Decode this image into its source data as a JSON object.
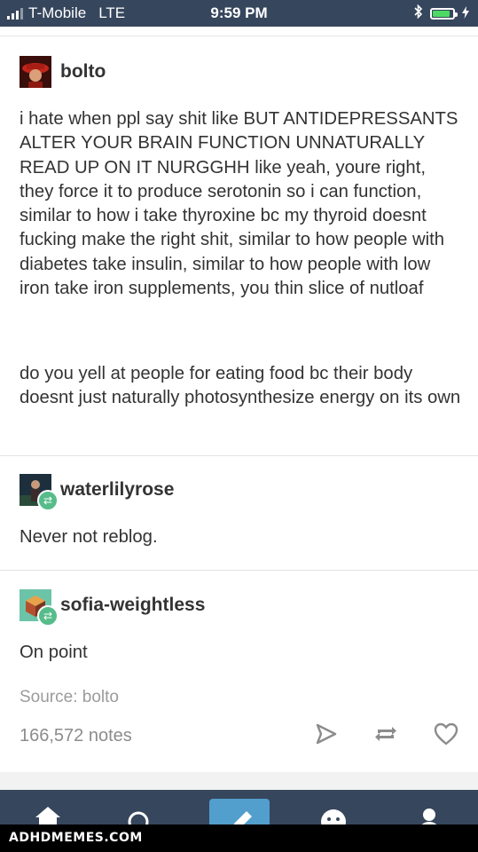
{
  "status_bar": {
    "carrier": "T-Mobile",
    "network": "LTE",
    "time": "9:59 PM",
    "battery_fraction": 0.85
  },
  "posts": [
    {
      "username": "bolto",
      "paragraphs": [
        "i hate when ppl say shit like BUT ANTIDEPRESSANTS ALTER YOUR BRAIN FUNCTION UNNATURALLY READ UP ON IT NURGGHH like yeah, youre right, they force it to produce serotonin so i can function, similar to how i take thyroxine bc my thyroid doesnt fucking make the right shit, similar to how people with diabetes take insulin, similar to how people with low iron take iron supplements, you thin slice of nutloaf",
        "do you yell at people for eating food bc their body doesnt just naturally photosynthesize energy on its own"
      ]
    },
    {
      "username": "waterlilyrose",
      "text": "Never not reblog."
    },
    {
      "username": "sofia-weightless",
      "text": "On point"
    }
  ],
  "footer": {
    "source": "Source: bolto",
    "notes": "166,572 notes"
  },
  "watermark": "ADHDMEMES.COM",
  "colors": {
    "nav": "#36465d",
    "accent": "#529ecc",
    "reblog": "#56bc8a"
  },
  "icons": [
    "share-icon",
    "reblog-icon",
    "heart-icon",
    "home-icon",
    "search-icon",
    "compose-icon",
    "smiley-icon",
    "account-icon"
  ]
}
